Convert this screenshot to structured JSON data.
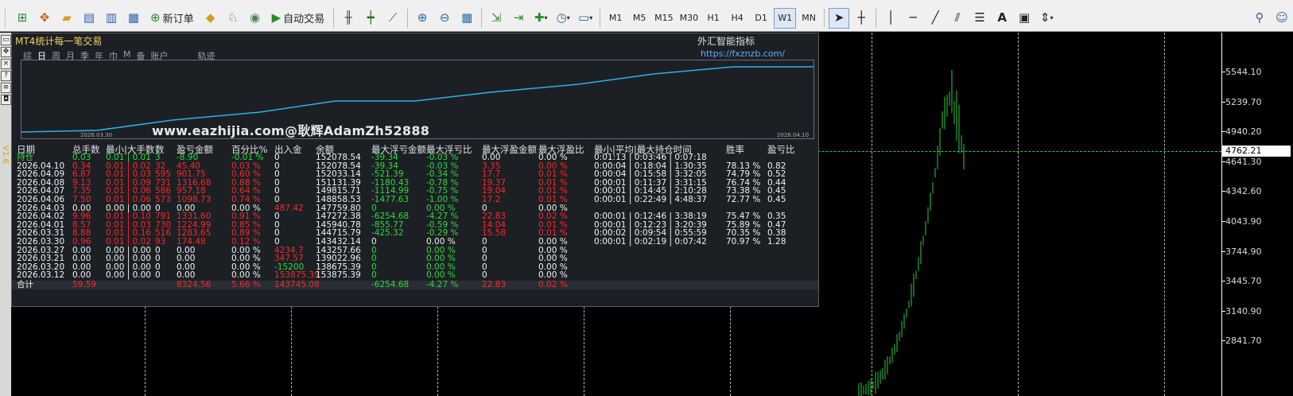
{
  "toolbar": {
    "new_order_label": "新订单",
    "auto_trade_label": "自动交易",
    "timeframes": [
      "M1",
      "M5",
      "M15",
      "M30",
      "H1",
      "H4",
      "D1",
      "W1",
      "MN"
    ],
    "active_timeframe": "W1"
  },
  "sidebar_label": "V1.6",
  "panel": {
    "title": "MT4统计每一笔交易",
    "brand": "外汇智能指标",
    "brand_url": "https://fxznzb.com/",
    "tabs": [
      "综",
      "日",
      "周",
      "月",
      "季",
      "年",
      "巾",
      "M",
      "备",
      "账户"
    ],
    "active_tab": "日",
    "track_label": "轨迹",
    "mini_chart": {
      "start_date": "2026.03.30",
      "end_date": "2026.04.10"
    },
    "watermark": "www.eazhijia.com@耿辉AdamZh52888",
    "headers": [
      "日期",
      "总手数",
      "最小|大手数",
      "数",
      "盈亏金额",
      "百分比%",
      "出入金",
      "余额",
      "最大浮亏金额",
      "最大浮亏比",
      "最大浮盈金额",
      "最大浮盈比",
      "最小|平均|最大持仓时间",
      "胜率",
      "盈亏比"
    ],
    "rows": [
      {
        "date": "持仓",
        "lots": "0.03",
        "minmax": "0.01 | 0.01",
        "n": "3",
        "pl": "-8.90",
        "pct": "-0.01 %",
        "io": "0",
        "bal": "152078.54",
        "mfl": "-39.34",
        "mflp": "-0.03 %",
        "mfp": "0.00",
        "mfpp": "0.00 %",
        "time": "0:01:13 | 0:03:46 | 0:07:18",
        "win": "",
        "rr": "",
        "c": {
          "date": "g",
          "lots": "g",
          "minmax": "g",
          "n": "g",
          "pl": "g",
          "pct": "g",
          "io": "w",
          "mfp": "w",
          "mfpp": "w"
        }
      },
      {
        "date": "2026.04.10",
        "lots": "0.34",
        "minmax": "0.01 | 0.02",
        "n": "32",
        "pl": "45.40",
        "pct": "0.03 %",
        "io": "0",
        "bal": "152078.54",
        "mfl": "-39.34",
        "mflp": "-0.03 %",
        "mfp": "3.35",
        "mfpp": "0.00 %",
        "time": "0:00:04 | 0:18:04 | 1:30:35",
        "win": "78.13 %",
        "rr": "0.82"
      },
      {
        "date": "2026.04.09",
        "lots": "6.87",
        "minmax": "0.01 | 0.03",
        "n": "595",
        "pl": "901.75",
        "pct": "0.60 %",
        "io": "0",
        "bal": "152033.14",
        "mfl": "-521.39",
        "mflp": "-0.34 %",
        "mfp": "17.7",
        "mfpp": "0.01 %",
        "time": "0:00:04 | 0:15:58 | 3:32:05",
        "win": "74.79 %",
        "rr": "0.52"
      },
      {
        "date": "2026.04.08",
        "lots": "9.13",
        "minmax": "0.01 | 0.09",
        "n": "731",
        "pl": "1316.68",
        "pct": "0.88 %",
        "io": "0",
        "bal": "151131.39",
        "mfl": "-1180.43",
        "mflp": "-0.78 %",
        "mfp": "19.37",
        "mfpp": "0.01 %",
        "time": "0:00:01 | 0:11:37 | 3:31:15",
        "win": "76.74 %",
        "rr": "0.44"
      },
      {
        "date": "2026.04.07",
        "lots": "7.35",
        "minmax": "0.01 | 0.06",
        "n": "586",
        "pl": "957.18",
        "pct": "0.64 %",
        "io": "0",
        "bal": "149815.71",
        "mfl": "-1114.99",
        "mflp": "-0.75 %",
        "mfp": "19.04",
        "mfpp": "0.01 %",
        "time": "0:00:01 | 0:14:45 | 2:10:28",
        "win": "73.38 %",
        "rr": "0.45"
      },
      {
        "date": "2026.04.06",
        "lots": "7.50",
        "minmax": "0.01 | 0.06",
        "n": "573",
        "pl": "1098.73",
        "pct": "0.74 %",
        "io": "0",
        "bal": "148858.53",
        "mfl": "-1477.63",
        "mflp": "-1.00 %",
        "mfp": "17.2",
        "mfpp": "0.01 %",
        "time": "0:00:01 | 0:22:49 | 4:48:37",
        "win": "72.77 %",
        "rr": "0.45"
      },
      {
        "date": "2026.04.03",
        "lots": "0.00",
        "minmax": "0.00 | 0.00",
        "n": "0",
        "pl": "0.00",
        "pct": "0.00 %",
        "io": "487.42",
        "bal": "147759.80",
        "mfl": "0",
        "mflp": "0.00 %",
        "mfp": "0",
        "mfpp": "0.00 %",
        "time": "",
        "win": "",
        "rr": "",
        "c": {
          "lots": "w",
          "minmax": "w",
          "n": "w",
          "pl": "w",
          "pct": "w",
          "io": "r",
          "mfp": "w",
          "mfpp": "w"
        }
      },
      {
        "date": "2026.04.02",
        "lots": "9.96",
        "minmax": "0.01 | 0.10",
        "n": "791",
        "pl": "1331.60",
        "pct": "0.91 %",
        "io": "0",
        "bal": "147272.38",
        "mfl": "-6254.68",
        "mflp": "-4.27 %",
        "mfp": "22.83",
        "mfpp": "0.02 %",
        "time": "0:00:01 | 0:12:46 | 3:38:19",
        "win": "75.47 %",
        "rr": "0.35"
      },
      {
        "date": "2026.04.01",
        "lots": "8.57",
        "minmax": "0.01 | 0.03",
        "n": "730",
        "pl": "1224.99",
        "pct": "0.85 %",
        "io": "0",
        "bal": "145940.78",
        "mfl": "-855.77",
        "mflp": "-0.59 %",
        "mfp": "14.04",
        "mfpp": "0.01 %",
        "time": "0:00:01 | 0:12:23 | 3:20:39",
        "win": "75.89 %",
        "rr": "0.47"
      },
      {
        "date": "2026.03.31",
        "lots": "8.88",
        "minmax": "0.01 | 0.16",
        "n": "516",
        "pl": "1283.65",
        "pct": "0.89 %",
        "io": "0",
        "bal": "144715.79",
        "mfl": "-425.32",
        "mflp": "-0.29 %",
        "mfp": "15.58",
        "mfpp": "0.01 %",
        "time": "0:00:02 | 0:09:54 | 0:55:59",
        "win": "70.35 %",
        "rr": "0.38"
      },
      {
        "date": "2026.03.30",
        "lots": "0.96",
        "minmax": "0.01 | 0.02",
        "n": "93",
        "pl": "174.48",
        "pct": "0.12 %",
        "io": "0",
        "bal": "143432.14",
        "mfl": "0",
        "mflp": "0.00 %",
        "mfp": "0",
        "mfpp": "0.00 %",
        "time": "0:00:01 | 0:02:19 | 0:07:42",
        "win": "70.97 %",
        "rr": "1.28",
        "c": {
          "mfl": "w",
          "mflp": "w",
          "mfp": "w",
          "mfpp": "w"
        }
      },
      {
        "date": "2026.03.27",
        "lots": "0.00",
        "minmax": "0.00 | 0.00",
        "n": "0",
        "pl": "0.00",
        "pct": "0.00 %",
        "io": "4234.7",
        "bal": "143257.66",
        "mfl": "0",
        "mflp": "0.00 %",
        "mfp": "0",
        "mfpp": "0.00 %",
        "time": "",
        "win": "",
        "rr": "",
        "c": {
          "lots": "w",
          "minmax": "w",
          "n": "w",
          "pl": "w",
          "pct": "w",
          "io": "r",
          "mfp": "w",
          "mfpp": "w"
        }
      },
      {
        "date": "2026.03.21",
        "lots": "0.00",
        "minmax": "0.00 | 0.00",
        "n": "0",
        "pl": "0.00",
        "pct": "0.00 %",
        "io": "347.57",
        "bal": "139022.96",
        "mfl": "0",
        "mflp": "0.00 %",
        "mfp": "0",
        "mfpp": "0.00 %",
        "time": "",
        "win": "",
        "rr": "",
        "c": {
          "lots": "w",
          "minmax": "w",
          "n": "w",
          "pl": "w",
          "pct": "w",
          "io": "r",
          "mfp": "w",
          "mfpp": "w"
        }
      },
      {
        "date": "2026.03.20",
        "lots": "0.00",
        "minmax": "0.00 | 0.00",
        "n": "0",
        "pl": "0.00",
        "pct": "0.00 %",
        "io": "-15200",
        "bal": "138675.39",
        "mfl": "0",
        "mflp": "0.00 %",
        "mfp": "0",
        "mfpp": "0.00 %",
        "time": "",
        "win": "",
        "rr": "",
        "c": {
          "lots": "w",
          "minmax": "w",
          "n": "w",
          "pl": "w",
          "pct": "w",
          "io": "g",
          "mfp": "w",
          "mfpp": "w"
        }
      },
      {
        "date": "2026.03.12",
        "lots": "0.00",
        "minmax": "0.00 | 0.00",
        "n": "0",
        "pl": "0.00",
        "pct": "0.00 %",
        "io": "153875.39",
        "bal": "153875.39",
        "mfl": "0",
        "mflp": "0.00 %",
        "mfp": "0",
        "mfpp": "0.00 %",
        "time": "",
        "win": "",
        "rr": "",
        "c": {
          "lots": "w",
          "minmax": "w",
          "n": "w",
          "pl": "w",
          "pct": "w",
          "io": "r",
          "mfp": "w",
          "mfpp": "w"
        }
      }
    ],
    "total": {
      "date": "合计",
      "lots": "59.59",
      "minmax": "",
      "n": "",
      "pl": "8324.56",
      "pct": "5.66 %",
      "io": "143745.08",
      "bal": "",
      "mfl": "-6254.68",
      "mflp": "-4.27 %",
      "mfp": "22.83",
      "mfpp": "0.02 %",
      "time": "",
      "win": "",
      "rr": ""
    }
  },
  "price_axis": {
    "labels": [
      "5544.10",
      "5239.70",
      "4940.20",
      "4641.30",
      "4342.60",
      "4043.90",
      "3744.90",
      "3445.70",
      "3140.90",
      "2841.70"
    ],
    "current_price": "4762.21"
  }
}
